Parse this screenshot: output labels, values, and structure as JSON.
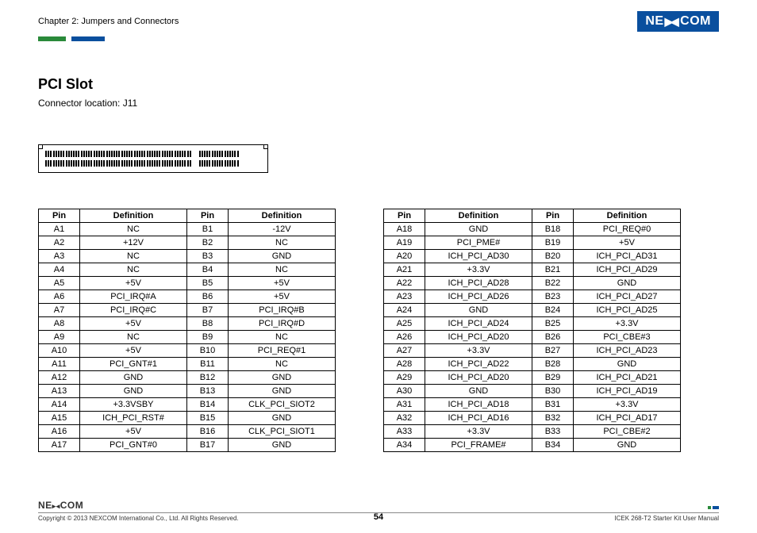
{
  "header": {
    "chapter": "Chapter 2: Jumpers and Connectors",
    "logo_text_left": "NE",
    "logo_text_right": "COM"
  },
  "section": {
    "title": "PCI Slot",
    "subtitle": "Connector location: J11"
  },
  "table_headers": {
    "pin": "Pin",
    "definition": "Definition"
  },
  "left_table": [
    {
      "pa": "A1",
      "da": "NC",
      "pb": "B1",
      "db": "-12V"
    },
    {
      "pa": "A2",
      "da": "+12V",
      "pb": "B2",
      "db": "NC"
    },
    {
      "pa": "A3",
      "da": "NC",
      "pb": "B3",
      "db": "GND"
    },
    {
      "pa": "A4",
      "da": "NC",
      "pb": "B4",
      "db": "NC"
    },
    {
      "pa": "A5",
      "da": "+5V",
      "pb": "B5",
      "db": "+5V"
    },
    {
      "pa": "A6",
      "da": "PCI_IRQ#A",
      "pb": "B6",
      "db": "+5V"
    },
    {
      "pa": "A7",
      "da": "PCI_IRQ#C",
      "pb": "B7",
      "db": "PCI_IRQ#B"
    },
    {
      "pa": "A8",
      "da": "+5V",
      "pb": "B8",
      "db": "PCI_IRQ#D"
    },
    {
      "pa": "A9",
      "da": "NC",
      "pb": "B9",
      "db": "NC"
    },
    {
      "pa": "A10",
      "da": "+5V",
      "pb": "B10",
      "db": "PCI_REQ#1"
    },
    {
      "pa": "A11",
      "da": "PCI_GNT#1",
      "pb": "B11",
      "db": "NC"
    },
    {
      "pa": "A12",
      "da": "GND",
      "pb": "B12",
      "db": "GND"
    },
    {
      "pa": "A13",
      "da": "GND",
      "pb": "B13",
      "db": "GND"
    },
    {
      "pa": "A14",
      "da": "+3.3VSBY",
      "pb": "B14",
      "db": "CLK_PCI_SIOT2"
    },
    {
      "pa": "A15",
      "da": "ICH_PCI_RST#",
      "pb": "B15",
      "db": "GND"
    },
    {
      "pa": "A16",
      "da": "+5V",
      "pb": "B16",
      "db": "CLK_PCI_SIOT1"
    },
    {
      "pa": "A17",
      "da": "PCI_GNT#0",
      "pb": "B17",
      "db": "GND"
    }
  ],
  "right_table": [
    {
      "pa": "A18",
      "da": "GND",
      "pb": "B18",
      "db": "PCI_REQ#0"
    },
    {
      "pa": "A19",
      "da": "PCI_PME#",
      "pb": "B19",
      "db": "+5V"
    },
    {
      "pa": "A20",
      "da": "ICH_PCI_AD30",
      "pb": "B20",
      "db": "ICH_PCI_AD31"
    },
    {
      "pa": "A21",
      "da": "+3.3V",
      "pb": "B21",
      "db": "ICH_PCI_AD29"
    },
    {
      "pa": "A22",
      "da": "ICH_PCI_AD28",
      "pb": "B22",
      "db": "GND"
    },
    {
      "pa": "A23",
      "da": "ICH_PCI_AD26",
      "pb": "B23",
      "db": "ICH_PCI_AD27"
    },
    {
      "pa": "A24",
      "da": "GND",
      "pb": "B24",
      "db": "ICH_PCI_AD25"
    },
    {
      "pa": "A25",
      "da": "ICH_PCI_AD24",
      "pb": "B25",
      "db": "+3.3V"
    },
    {
      "pa": "A26",
      "da": "ICH_PCI_AD20",
      "pb": "B26",
      "db": "PCI_CBE#3"
    },
    {
      "pa": "A27",
      "da": "+3.3V",
      "pb": "B27",
      "db": "ICH_PCI_AD23"
    },
    {
      "pa": "A28",
      "da": "ICH_PCI_AD22",
      "pb": "B28",
      "db": "GND"
    },
    {
      "pa": "A29",
      "da": "ICH_PCI_AD20",
      "pb": "B29",
      "db": "ICH_PCI_AD21"
    },
    {
      "pa": "A30",
      "da": "GND",
      "pb": "B30",
      "db": "ICH_PCI_AD19"
    },
    {
      "pa": "A31",
      "da": "ICH_PCI_AD18",
      "pb": "B31",
      "db": "+3.3V"
    },
    {
      "pa": "A32",
      "da": "ICH_PCI_AD16",
      "pb": "B32",
      "db": "ICH_PCI_AD17"
    },
    {
      "pa": "A33",
      "da": "+3.3V",
      "pb": "B33",
      "db": "PCI_CBE#2"
    },
    {
      "pa": "A34",
      "da": "PCI_FRAME#",
      "pb": "B34",
      "db": "GND"
    }
  ],
  "footer": {
    "logo": "NE COM",
    "copyright": "Copyright © 2013 NEXCOM International Co., Ltd. All Rights Reserved.",
    "page": "54",
    "doc": "ICEK 268-T2 Starter Kit User Manual"
  }
}
